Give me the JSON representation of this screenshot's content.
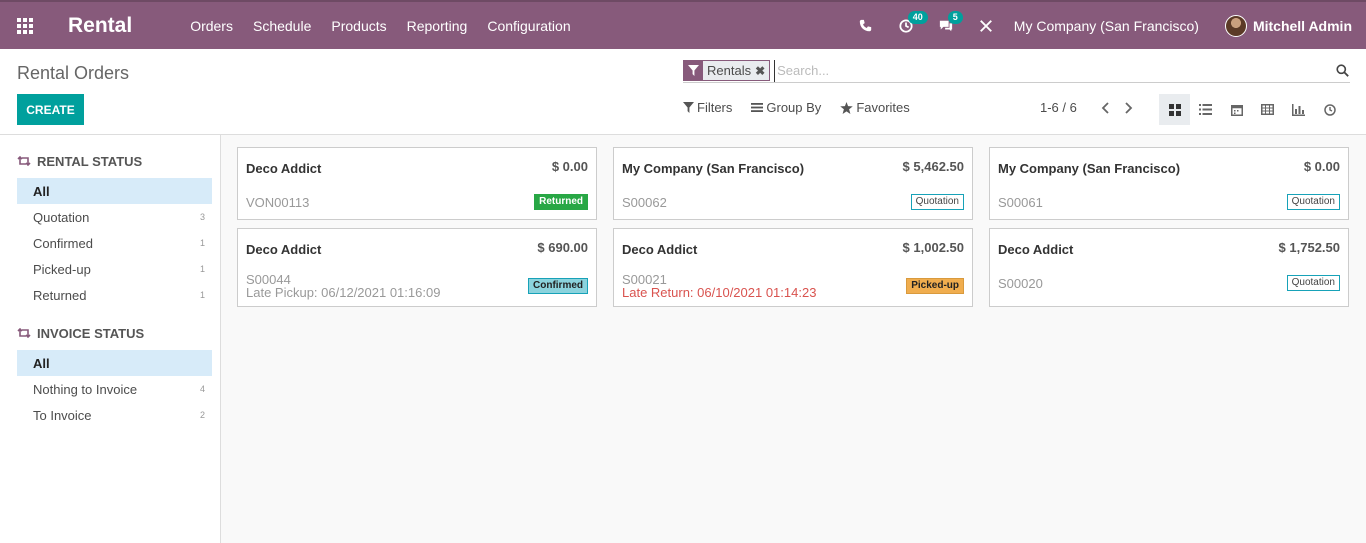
{
  "app": {
    "title": "Rental",
    "menu": [
      "Orders",
      "Schedule",
      "Products",
      "Reporting",
      "Configuration"
    ]
  },
  "systray": {
    "activity_count": "40",
    "messages_count": "5",
    "company": "My Company (San Francisco)",
    "user": "Mitchell Admin"
  },
  "control_panel": {
    "title": "Rental Orders",
    "create_label": "CREATE",
    "search": {
      "facet_label": "Rentals",
      "placeholder": "Search..."
    },
    "filters_label": "Filters",
    "group_by_label": "Group By",
    "favorites_label": "Favorites",
    "pager": "1-6 / 6"
  },
  "sidebar": {
    "rental_status": {
      "title": "RENTAL STATUS",
      "items": [
        {
          "label": "All",
          "count": ""
        },
        {
          "label": "Quotation",
          "count": "3"
        },
        {
          "label": "Confirmed",
          "count": "1"
        },
        {
          "label": "Picked-up",
          "count": "1"
        },
        {
          "label": "Returned",
          "count": "1"
        }
      ]
    },
    "invoice_status": {
      "title": "INVOICE STATUS",
      "items": [
        {
          "label": "All",
          "count": ""
        },
        {
          "label": "Nothing to Invoice",
          "count": "4"
        },
        {
          "label": "To Invoice",
          "count": "2"
        }
      ]
    }
  },
  "cards": [
    {
      "partner": "Deco Addict",
      "amount": "$ 0.00",
      "ref": "VON00113",
      "detail": "",
      "status": "Returned"
    },
    {
      "partner": "My Company (San Francisco)",
      "amount": "$ 5,462.50",
      "ref": "S00062",
      "detail": "",
      "status": "Quotation"
    },
    {
      "partner": "My Company (San Francisco)",
      "amount": "$ 0.00",
      "ref": "S00061",
      "detail": "",
      "status": "Quotation"
    },
    {
      "partner": "Deco Addict",
      "amount": "$ 690.00",
      "ref": "S00044",
      "detail": "Late Pickup: 06/12/2021 01:16:09",
      "status": "Confirmed"
    },
    {
      "partner": "Deco Addict",
      "amount": "$ 1,002.50",
      "ref": "S00021",
      "detail": "Late Return: 06/10/2021 01:14:23",
      "status": "Picked-up"
    },
    {
      "partner": "Deco Addict",
      "amount": "$ 1,752.50",
      "ref": "S00020",
      "detail": "",
      "status": "Quotation"
    }
  ],
  "colors": {
    "navbar": "#875a7b",
    "primary": "#00a09d",
    "late_text": "#d9534f"
  }
}
